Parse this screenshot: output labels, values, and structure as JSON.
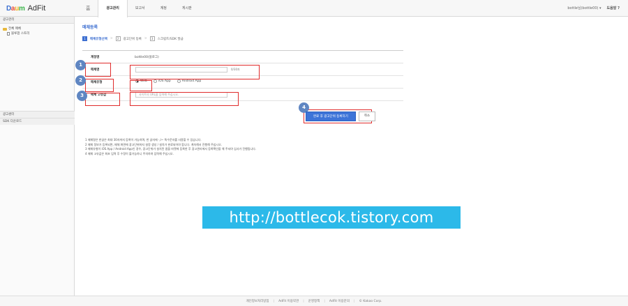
{
  "header": {
    "logo": {
      "brand": "Daum",
      "product": "AdFit"
    },
    "nav": [
      "홈",
      "광고관리",
      "보고서",
      "계정",
      "게시판"
    ],
    "active_nav_index": 1,
    "user": "bottle님(bottle00) ▾",
    "help": "도움말 ?"
  },
  "sidebar": {
    "title": "광고관리",
    "tree": [
      {
        "label": "전체 매체",
        "type": "folder"
      },
      {
        "label": "블루팜 스토리",
        "type": "doc"
      }
    ],
    "lower": [
      "광고센터",
      "SDK 다운로드"
    ]
  },
  "main": {
    "page_title": "매체등록",
    "steps": [
      {
        "num": "1",
        "label": "매체유형선택",
        "active": true
      },
      {
        "num": "2",
        "label": "광고단위 등록",
        "active": false
      },
      {
        "num": "3",
        "label": "스크립트/SDK 발급",
        "active": false
      }
    ],
    "step_separator": ">",
    "form": {
      "account": {
        "label": "계정명",
        "value": "bottle00(블로그)"
      },
      "name": {
        "label": "매체명",
        "value": "",
        "counter": "0/30자"
      },
      "type": {
        "label": "매체유형",
        "options": [
          "Web",
          "iOS App",
          "Android App"
        ],
        "selected": "Web"
      },
      "unique": {
        "label": "매체 고유값",
        "placeholder": "사이트의 URL을 입력해 주십시오."
      }
    },
    "buttons": {
      "primary": "완료 후 광고단위 등록하기",
      "cancel": "취소"
    },
    "badges": [
      "1",
      "2",
      "3",
      "4"
    ],
    "notes": [
      "1 매체명은 한글은 최대 30자까지 등록이 가능하며, 한 글자에 -,/~ 특수문자를 사용할 수 있습니다.",
      "2 매체 정보가 등록되면, 매체 화면에 광고단위까지 설정 생성 / 설치가 완료되어야 합니다. 계속해서 진행해 주십시오.",
      "3 매체유형이 iOS App / Android App인 경우, 광고단위가 설치된 앱을 마켓에 등록한 후 광고관리에서 등록확인을 해 주셔야 심사가 진행됩니다.",
      "4 매체 고유값은 최초 입력 후 수정이 불가능하니 주의하여 입력해 주십시오."
    ]
  },
  "watermark": "http://bottlecok.tistory.com",
  "footer": [
    "개인정보처리방침",
    "AdFit 이용약관",
    "운영정책",
    "AdFit 이용문의",
    "© Kakao Corp."
  ],
  "colors": {
    "accent": "#3d74d8",
    "highlight": "#e02b2b",
    "badge": "#5f86c2",
    "watermark": "#2cb9e9"
  }
}
